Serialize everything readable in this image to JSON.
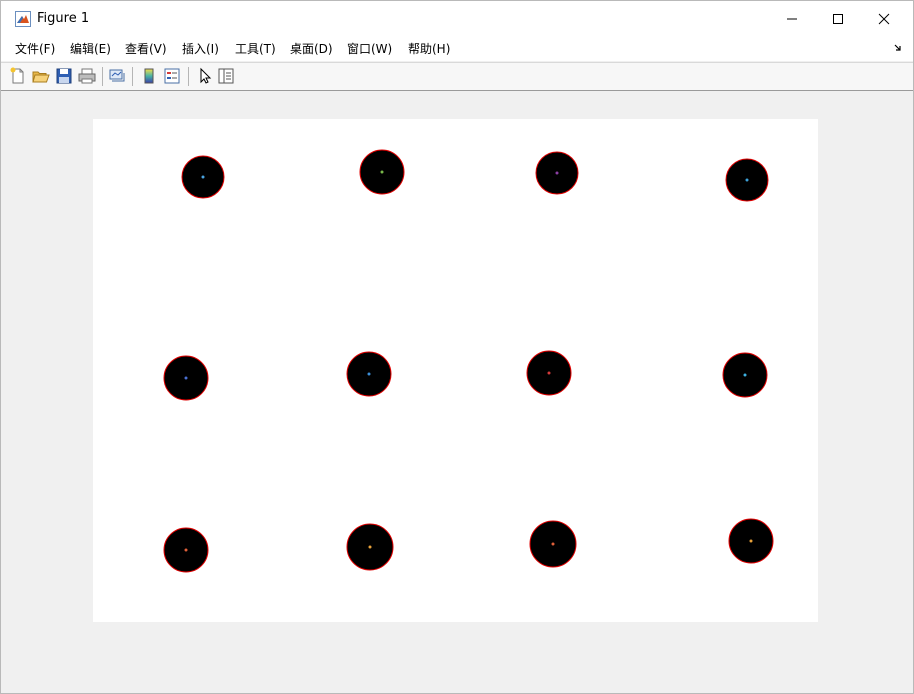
{
  "window": {
    "title": "Figure 1",
    "minimize_glyph": "—",
    "maximize_glyph": "□",
    "close_glyph": "✕"
  },
  "menu": {
    "items": [
      {
        "label": "文件(F)"
      },
      {
        "label": "编辑(E)"
      },
      {
        "label": "查看(V)"
      },
      {
        "label": "插入(I)"
      },
      {
        "label": "工具(T)"
      },
      {
        "label": "桌面(D)"
      },
      {
        "label": "窗口(W)"
      },
      {
        "label": "帮助(H)"
      }
    ]
  },
  "toolbar": {
    "buttons": [
      {
        "icon": "new-figure-icon"
      },
      {
        "icon": "open-file-icon"
      },
      {
        "icon": "save-icon"
      },
      {
        "icon": "print-icon"
      },
      {
        "icon": "link-plot-icon"
      },
      {
        "icon": "insert-colorbar-icon"
      },
      {
        "icon": "insert-legend-icon"
      },
      {
        "icon": "edit-plot-arrow-icon"
      },
      {
        "icon": "property-inspector-icon"
      }
    ]
  },
  "chart_data": {
    "type": "scatter",
    "title": "",
    "xlabel": "",
    "ylabel": "",
    "grid": false,
    "axes_visible": false,
    "background": "#ffffff",
    "blob_fill": "#000000",
    "circle_stroke": "#e00000",
    "center_colors": [
      "#4aa3df",
      "#79b84a",
      "#8b3fa3",
      "#3da0d8",
      "#4a6fd1",
      "#3d8fd8",
      "#d43a3a",
      "#3db0e0",
      "#e0603a",
      "#e8a23a",
      "#e0603a",
      "#e8a23a"
    ],
    "rows": [
      {
        "row": 1,
        "count": 4
      },
      {
        "row": 2,
        "count": 4
      },
      {
        "row": 3,
        "count": 4
      }
    ]
  }
}
